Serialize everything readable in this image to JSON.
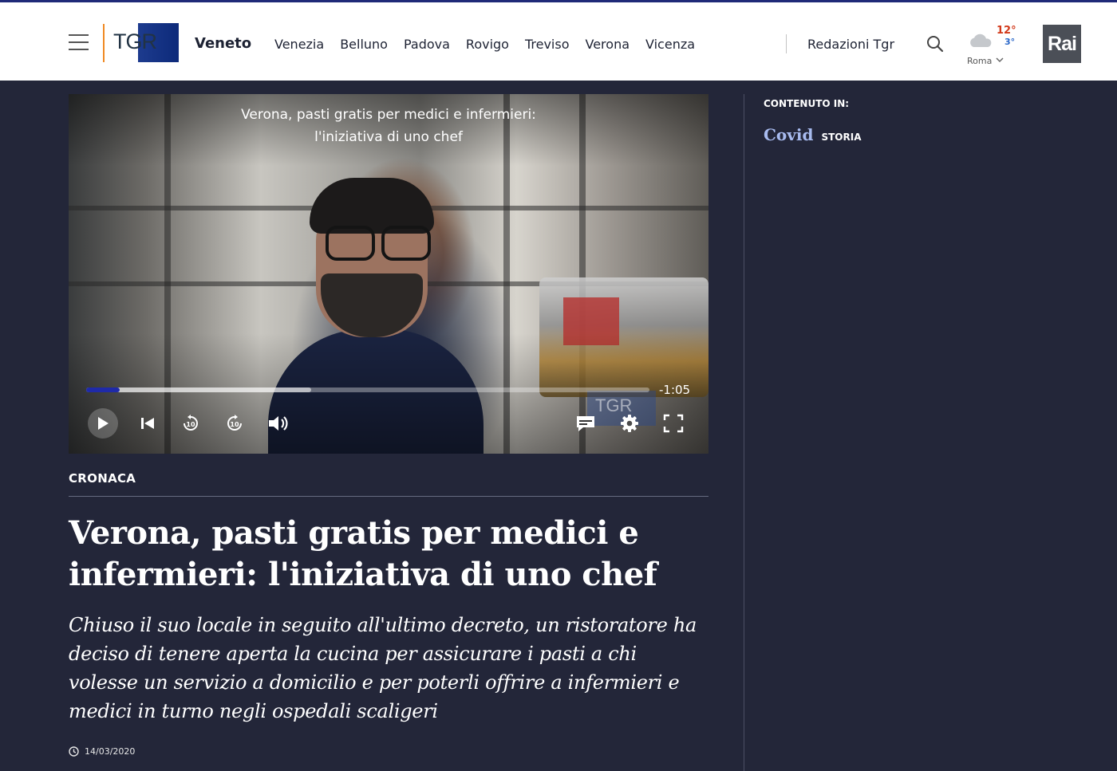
{
  "header": {
    "logo_text": "TGR",
    "region": "Veneto",
    "nav": [
      "Venezia",
      "Belluno",
      "Padova",
      "Rovigo",
      "Treviso",
      "Verona",
      "Vicenza"
    ],
    "redazioni": "Redazioni Tgr",
    "weather": {
      "temp_high": "12°",
      "temp_low": "3°",
      "city": "Roma"
    },
    "rai_logo": "Rai"
  },
  "video": {
    "title_line1": "Verona, pasti gratis per medici e infermieri:",
    "title_line2": "l'iniziativa di uno chef",
    "watermark": "TGR",
    "remaining": "-1:05",
    "played_fraction": 0.06,
    "buffered_fraction": 0.4
  },
  "article": {
    "category": "CRONACA",
    "headline": "Verona, pasti gratis per medici e infermieri: l'iniziativa di uno chef",
    "subtitle": "Chiuso il suo locale in seguito all'ultimo decreto, un ristoratore ha deciso di tenere aperta la cucina per assicurare i pasti a chi volesse un servizio a domicilio e per poterli offrire a infermieri e medici in turno negli ospedali scaligeri",
    "date": "14/03/2020"
  },
  "sidebar": {
    "label": "CONTENUTO IN:",
    "tag_name": "Covid",
    "tag_type": "STORIA"
  }
}
